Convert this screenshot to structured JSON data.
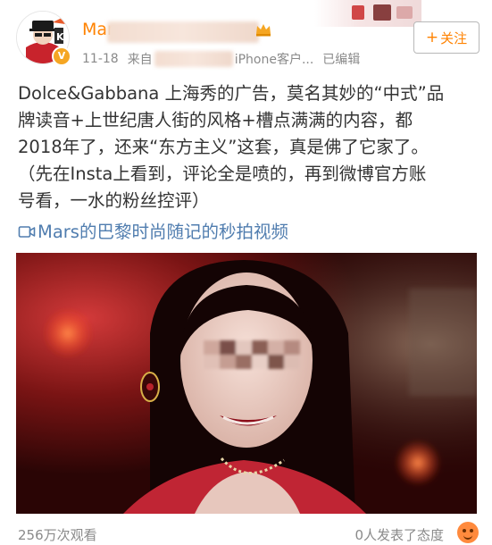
{
  "header": {
    "username": "Mar",
    "date": "11-18",
    "source_prefix": "来自",
    "source_suffix": "iPhone客户...",
    "edited": "已编辑",
    "follow_label": "关注",
    "follow_plus": "+"
  },
  "post": {
    "lines": [
      "Dolce&Gabbana 上海秀的广告，莫名其妙的“中式”品",
      "牌读音+上世纪唐人街的风格+槽点满满的内容，都",
      "2018年了，还来“东方主义”这套，真是佛了它家了。",
      "（先在Insta上看到，评论全是喷的，再到微博官方账",
      "号看，一水的粉丝控评）"
    ],
    "video_link": "Mars的巴黎时尚随记的秒拍视频"
  },
  "footer": {
    "views": "256万次观看",
    "attitude": "0人发表了态度"
  },
  "icons": {
    "video": "video-icon",
    "crown": "crown-icon",
    "verified": "verified-badge-icon",
    "reaction": "reaction-emoji-icon"
  },
  "colors": {
    "accent": "#ff8200",
    "link": "#507daf",
    "muted": "#8a8a8a",
    "text": "#333333",
    "verified_badge": "#f5a623"
  }
}
